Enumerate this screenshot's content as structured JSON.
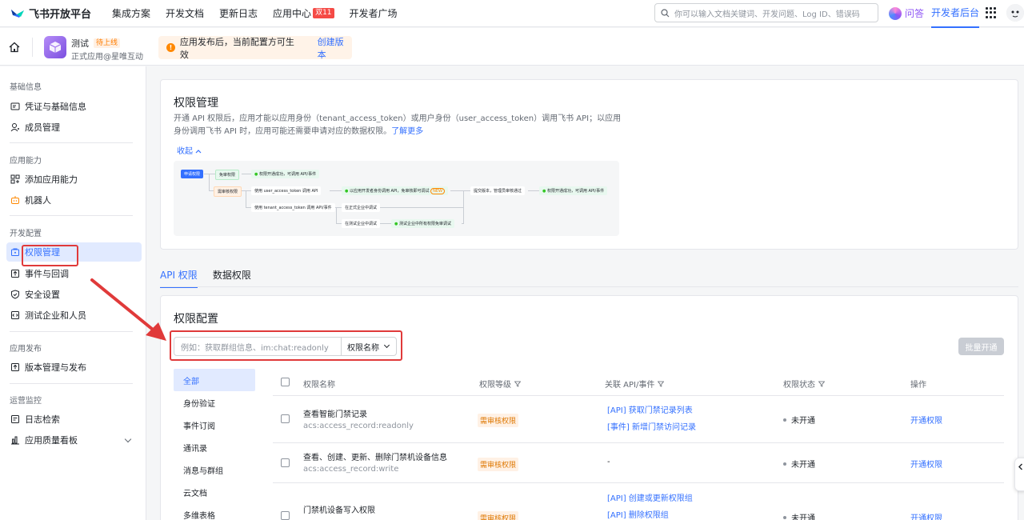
{
  "topnav": {
    "brand": "飞书开放平台",
    "items": [
      "集成方案",
      "开发文档",
      "更新日志",
      "应用中心",
      "开发者广场"
    ],
    "app_center_badge": "双11",
    "search_placeholder": "你可以输入文档关键词、开发问题、Log ID、错误码",
    "ask_label": "问答",
    "dev_console_label": "开发者后台"
  },
  "appbar": {
    "app_name": "测试",
    "app_status": "待上线",
    "app_sub": "正式应用@星唯互动",
    "notice_text": "应用发布后，当前配置方可生效",
    "notice_link": "创建版本"
  },
  "sidebar": {
    "groups": [
      "基础信息",
      "应用能力",
      "开发配置",
      "应用发布",
      "运营监控"
    ],
    "items": [
      {
        "label": "凭证与基础信息",
        "icon": "credential-icon"
      },
      {
        "label": "成员管理",
        "icon": "member-icon"
      },
      {
        "label": "添加应用能力",
        "icon": "grid-add-icon"
      },
      {
        "label": "机器人",
        "icon": "robot-icon"
      },
      {
        "label": "权限管理",
        "icon": "permission-icon"
      },
      {
        "label": "事件与回调",
        "icon": "event-icon"
      },
      {
        "label": "安全设置",
        "icon": "shield-icon"
      },
      {
        "label": "测试企业和人员",
        "icon": "test-icon"
      },
      {
        "label": "版本管理与发布",
        "icon": "upload-icon"
      },
      {
        "label": "日志检索",
        "icon": "log-icon"
      },
      {
        "label": "应用质量看板",
        "icon": "chart-icon"
      }
    ]
  },
  "permission": {
    "title": "权限管理",
    "desc": "开通 API 权限后，应用才能以应用身份（tenant_access_token）或用户身份（user_access_token）调用飞书 API；以应用身份调用飞书 API 时，应用可能还需要申请对应的数据权限。",
    "learn_more": "了解更多",
    "collapse": "收起",
    "flow": {
      "apply": "申请权限",
      "no_review": "免审权限",
      "success1": "权限开通成功，可调用 API/事件",
      "need_review": "需审核权限",
      "use_user": "使用 user_access_token 调用 API",
      "debug": "以应用开发者身份调用 API，免审核即可调试",
      "new": "NEW",
      "submit": "提交版本，管理员审核通过",
      "success2": "权限开通成功，可调用 API/事件",
      "use_tenant": "使用 tenant_access_token 调用 API/事件",
      "formal_debug": "在正式企业中调试",
      "test_debug": "在测试企业中调试",
      "test_free": "测试企业中所有权限免审调试"
    }
  },
  "tabs": [
    "API 权限",
    "数据权限"
  ],
  "config": {
    "title": "权限配置",
    "filter_placeholder": "例如：获取群组信息、im:chat:readonly",
    "filter_select": "权限名称",
    "batch_button": "批量开通",
    "categories": [
      "全部",
      "身份验证",
      "事件订阅",
      "通讯录",
      "消息与群组",
      "云文档",
      "多维表格"
    ],
    "columns": [
      "权限名称",
      "权限等级",
      "关联 API/事件",
      "权限状态",
      "操作"
    ],
    "rows": [
      {
        "name": "查看智能门禁记录",
        "scope": "acs:access_record:readonly",
        "level": "需审核权限",
        "apis": [
          "[API] 获取门禁记录列表",
          "[事件] 新增门禁访问记录"
        ],
        "status": "未开通",
        "action": "开通权限"
      },
      {
        "name": "查看、创建、更新、删除门禁机设备信息",
        "scope": "acs:access_record:write",
        "level": "需审核权限",
        "apis": [
          "-"
        ],
        "status": "未开通",
        "action": "开通权限"
      },
      {
        "name": "门禁机设备写入权限",
        "scope": "",
        "level": "需审核权限",
        "apis": [
          "[API] 创建或更新权限组",
          "[API] 删除权限组"
        ],
        "status": "未开通",
        "action": "开通权限"
      }
    ]
  },
  "colors": {
    "accent": "#3370ff",
    "annotation": "#e03a3a"
  }
}
